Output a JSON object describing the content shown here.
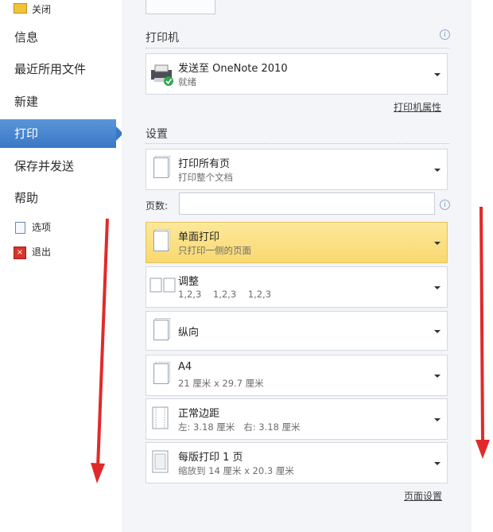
{
  "nav": {
    "close": "关闭",
    "info": "信息",
    "recent": "最近所用文件",
    "new": "新建",
    "print": "打印",
    "save_send": "保存并发送",
    "help": "帮助",
    "options": "选项",
    "exit": "退出"
  },
  "printer": {
    "section_title": "打印机",
    "name": "发送至 OneNote 2010",
    "status": "就绪",
    "properties_link": "打印机属性"
  },
  "settings": {
    "section_title": "设置",
    "print_range": {
      "main": "打印所有页",
      "sub": "打印整个文档"
    },
    "pages_label": "页数:",
    "pages_value": "",
    "sides": {
      "main": "单面打印",
      "sub": "只打印一侧的页面"
    },
    "collate": {
      "main": "调整",
      "sub": "1,2,3    1,2,3    1,2,3"
    },
    "orientation": {
      "main": "纵向"
    },
    "paper": {
      "main": "A4",
      "sub": "21 厘米 x 29.7 厘米"
    },
    "margins": {
      "main": "正常边距",
      "sub": "左: 3.18 厘米   右: 3.18 厘米"
    },
    "pages_per_sheet": {
      "main": "每版打印 1 页",
      "sub": "缩放到 14 厘米 x 20.3 厘米"
    },
    "page_setup_link": "页面设置"
  },
  "colors": {
    "active_nav": "#3a78c6",
    "highlight": "#f9d870",
    "arrow": "#e02a2a"
  }
}
